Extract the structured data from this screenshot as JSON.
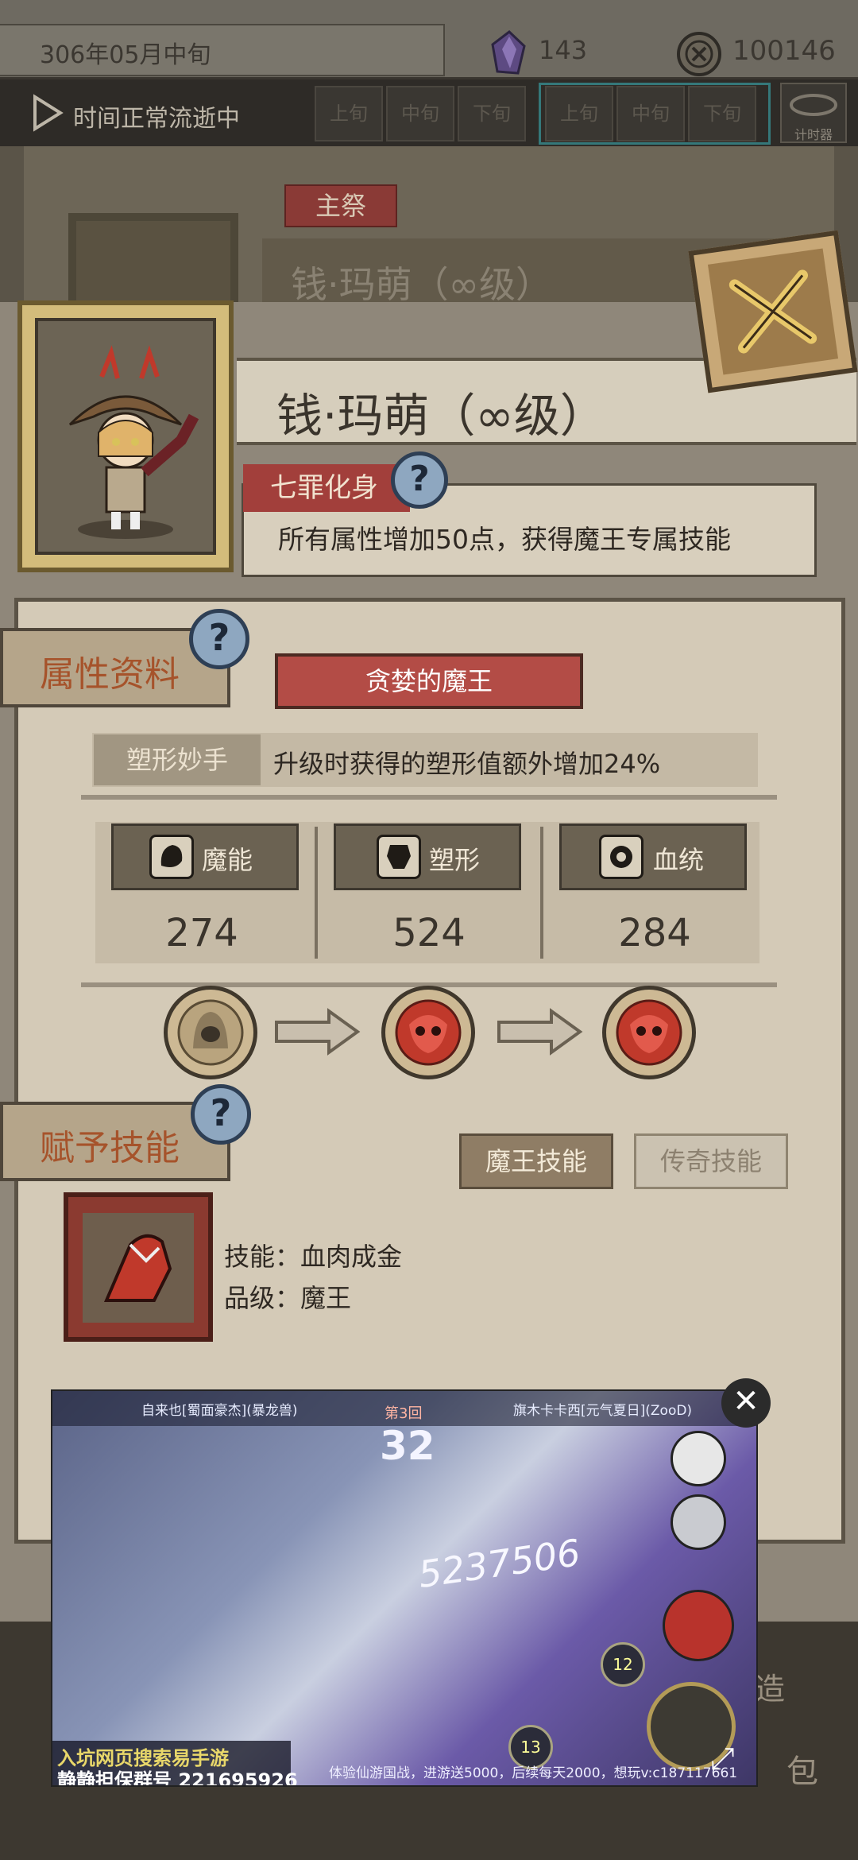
{
  "topbar": {
    "date": "306年05月中旬",
    "crystals": "143",
    "coins": "100146",
    "time_status": "时间正常流逝中",
    "time_slots_a": [
      "上旬",
      "中旬",
      "下旬"
    ],
    "time_slots_b": [
      "上旬",
      "中旬",
      "下旬"
    ],
    "timer_label": "计时器"
  },
  "background": {
    "master_tag": "主祭",
    "ghost_title": "钱·玛萌（∞级）"
  },
  "character": {
    "name": "钱·玛萌（∞级）",
    "sin_tag": "七罪化身",
    "sin_desc": "所有属性增加50点，获得魔王专属技能",
    "help_glyph": "?"
  },
  "attributes": {
    "section_title": "属性资料",
    "banner": "贪婪的魔王",
    "passive_tag": "塑形妙手",
    "passive_desc": "升级时获得的塑形值额外增加24%",
    "stats": [
      {
        "name": "魔能",
        "value": "274",
        "icon": "demon-power-icon"
      },
      {
        "name": "塑形",
        "value": "524",
        "icon": "body-shape-icon"
      },
      {
        "name": "血统",
        "value": "284",
        "icon": "bloodline-icon"
      }
    ]
  },
  "skills": {
    "section_title": "赋予技能",
    "tab_demon": "魔王技能",
    "tab_legend": "传奇技能",
    "skill_name": "技能：血肉成金",
    "skill_grade": "品级：魔王"
  },
  "bottom": {
    "item_right_1": "造",
    "item_right_2": "包"
  },
  "ad": {
    "player_left": "自来也[蜀面豪杰](暴龙兽)",
    "player_right": "旗木卡卡西[元气夏日](ZooD)",
    "round": "第3回",
    "timer": "32",
    "damage": "5237506",
    "promo_line1": "入坑网页搜索易手游",
    "promo_line2": "静静担保群号 221695926",
    "footer": "体验仙游国战，进游送5000，后续每天2000，想玩v:c187117661",
    "level_a": "12",
    "level_b": "13",
    "close_glyph": "✕",
    "expand_glyph": "⤢"
  },
  "colors": {
    "accent_red": "#b34c46",
    "gold": "#d3bc7b",
    "parchment": "#d4cab7",
    "help_blue": "#8ea7c0"
  }
}
